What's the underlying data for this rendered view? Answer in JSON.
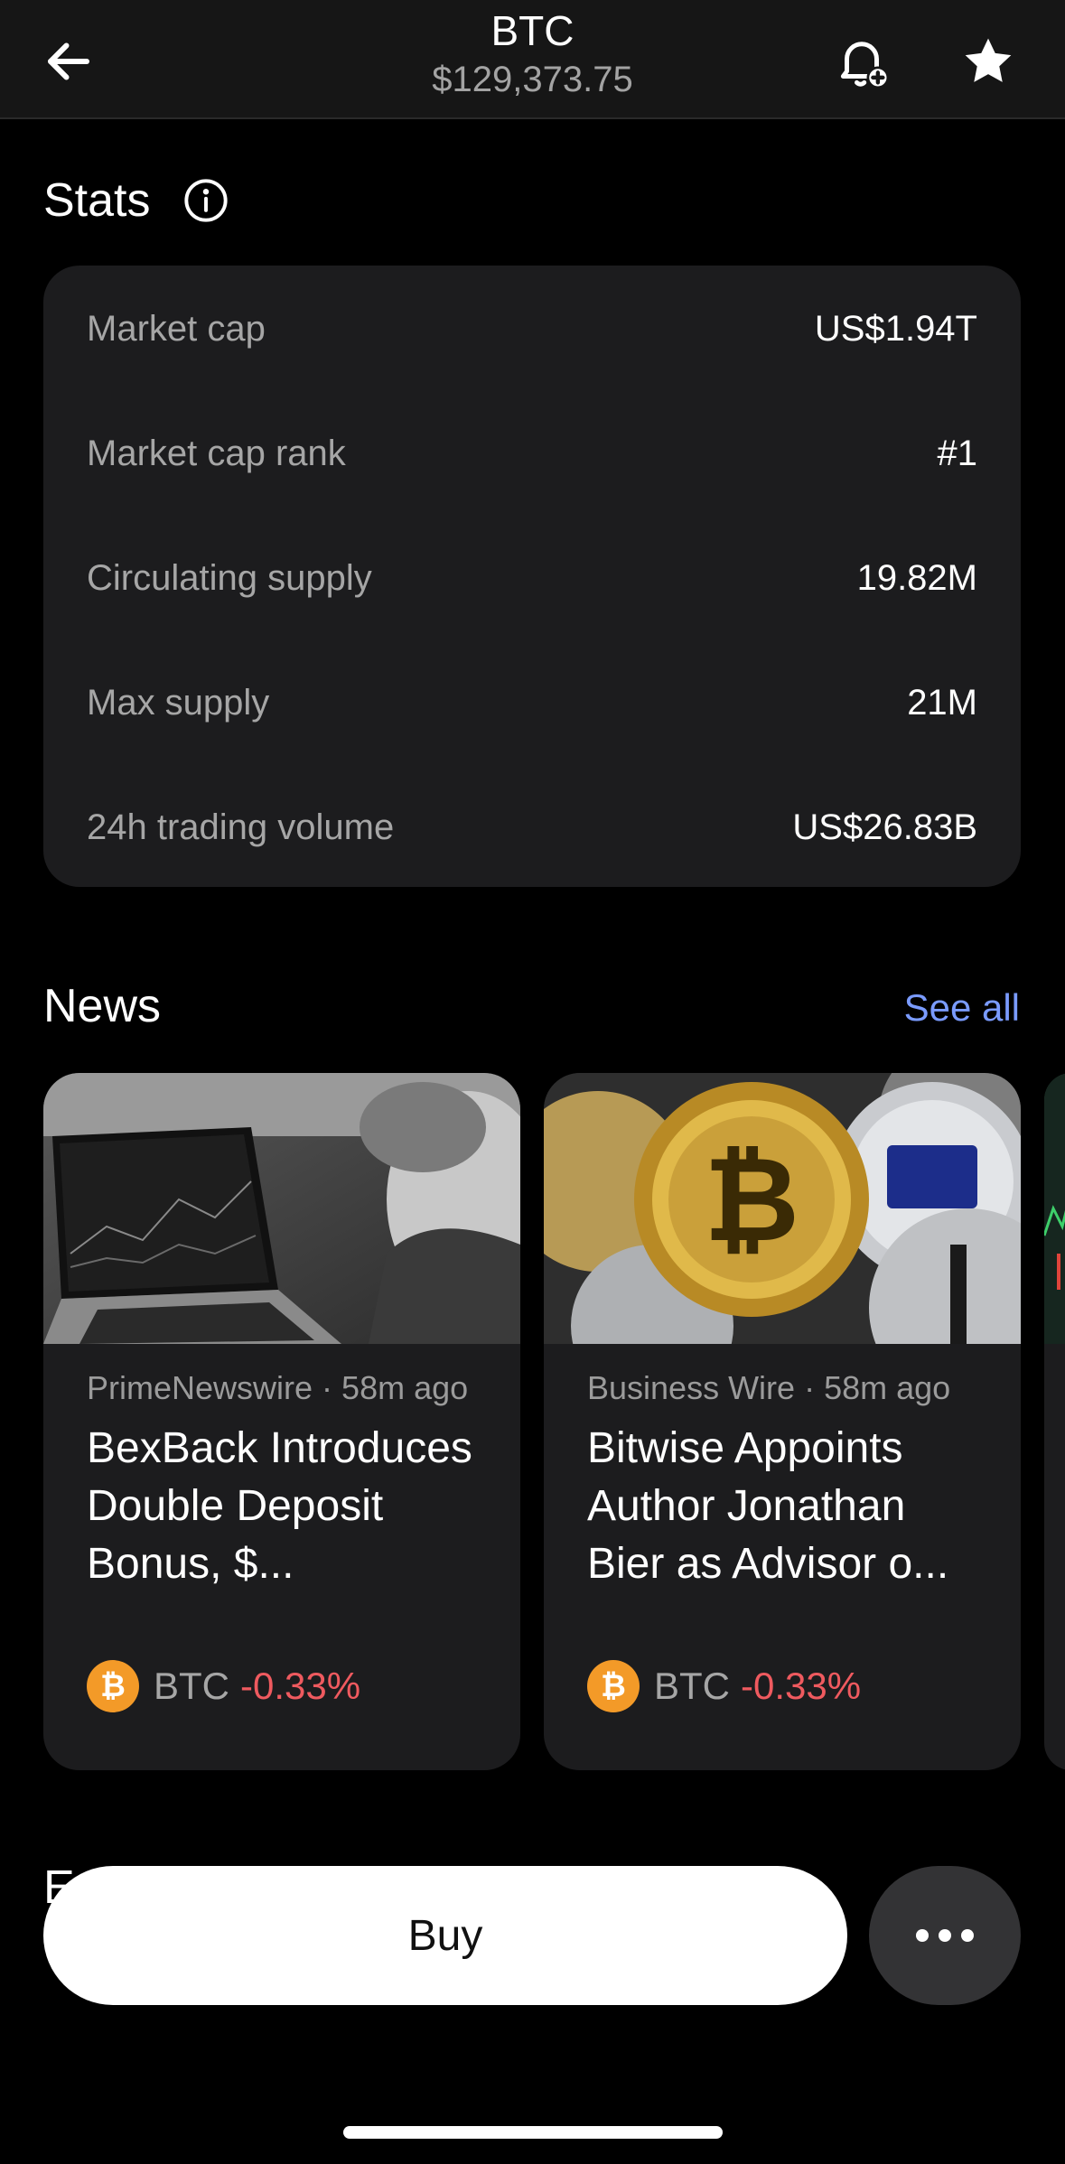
{
  "header": {
    "title": "BTC",
    "price": "$129,373.75"
  },
  "stats": {
    "title": "Stats",
    "rows": [
      {
        "label": "Market cap",
        "value": "US$1.94T"
      },
      {
        "label": "Market cap rank",
        "value": "#1"
      },
      {
        "label": "Circulating supply",
        "value": "19.82M"
      },
      {
        "label": "Max supply",
        "value": "21M"
      },
      {
        "label": "24h trading volume",
        "value": "US$26.83B"
      }
    ]
  },
  "news": {
    "title": "News",
    "see_all": "See all",
    "items": [
      {
        "source": "PrimeNewswire",
        "time": "58m ago",
        "headline": "BexBack Introduces Double Deposit Bonus, $...",
        "coin": "BTC",
        "change": "-0.33%"
      },
      {
        "source": "Business Wire",
        "time": "58m ago",
        "headline": "Bitwise Appoints Author Jonathan Bier as Advisor o...",
        "coin": "BTC",
        "change": "-0.33%"
      }
    ]
  },
  "next_section_partial": "E",
  "actions": {
    "buy_label": "Buy"
  },
  "colors": {
    "accent_link": "#7a9bff",
    "negative": "#ef5a5f",
    "bitcoin": "#f39a28"
  },
  "icons": {
    "back": "arrow-left-icon",
    "alert": "bell-plus-icon",
    "favorite": "star-icon",
    "info": "info-icon",
    "coin": "bitcoin-icon",
    "more": "more-horizontal-icon"
  }
}
